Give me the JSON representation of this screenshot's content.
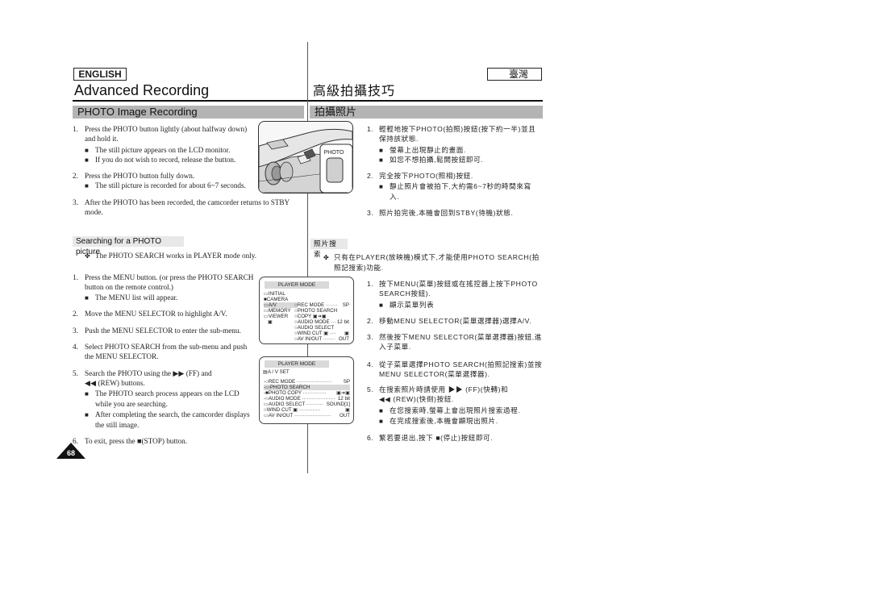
{
  "header": {
    "lang_en": "ENGLISH",
    "lang_zh": "臺灣",
    "title_en": "Advanced Recording",
    "title_zh": "高級拍攝技巧",
    "section_en": "PHOTO Image Recording",
    "section_zh": "拍攝照片"
  },
  "camera_image": {
    "label": "PHOTO"
  },
  "en_steps_top": [
    {
      "num": "1.",
      "lines": [
        "Press the PHOTO button lightly (about halfway down)",
        "and hold it."
      ]
    },
    {
      "bullet": "The still picture appears on the LCD monitor."
    },
    {
      "bullet": "If you do not wish to record, release the button."
    },
    {
      "num": "2.",
      "lines": [
        "Press the PHOTO button fully down."
      ]
    },
    {
      "bullet": "The still picture is recorded for about 6~7 seconds."
    },
    {
      "num": "3.",
      "lines": [
        "After the PHOTO has been recorded, the camcorder returns to STBY",
        "mode."
      ]
    }
  ],
  "zh_steps_top": [
    {
      "num": "1.",
      "lines": [
        "輕輕地按下PHOTO(拍照)按鈕(按下約一半)並且",
        "保持該狀態."
      ]
    },
    {
      "bullet": "螢幕上出現靜止的畫面."
    },
    {
      "bullet": "如您不想拍攝,鬆開按鈕即可."
    },
    {
      "num": "2.",
      "lines": [
        "完全按下PHOTO(照相)按鈕."
      ]
    },
    {
      "bullet": "靜止照片會被拍下,大約需6~7秒的時間來寫",
      "cont": "入."
    },
    {
      "num": "3.",
      "lines": [
        "照片拍完後,本機會回到STBY(待機)狀態."
      ]
    }
  ],
  "search_section": {
    "title_en": "Searching for a PHOTO picture",
    "title_zh": "照片搜索",
    "note_en": "The PHOTO SEARCH works in PLAYER mode only.",
    "note_zh": [
      "只有在PLAYER(放映機)模式下,才能使用PHOTO SEARCH(拍",
      "照記搜索)功能."
    ],
    "note_icon": "✤"
  },
  "en_steps_search": {
    "s1": [
      "Press the MENU button. (or press the PHOTO SEARCH",
      "button on the remote control.)"
    ],
    "s1b": "The MENU list will appear.",
    "s2": "Move the MENU SELECTOR to highlight A/V.",
    "s3": "Push the MENU SELECTOR to enter the sub-menu.",
    "s4": [
      "Select PHOTO SEARCH from the sub-menu and push",
      "the MENU SELECTOR."
    ],
    "s5a": "Search the PHOTO using the",
    "s5b": "(FF) and",
    "s5c": "(REW) buttons.",
    "s5b1": [
      "The PHOTO search process appears on the LCD",
      "while you are searching."
    ],
    "s5b2": [
      "After completing the search, the camcorder displays",
      "the still image."
    ],
    "s6a": "To exit, press the",
    "s6b": "(STOP) button."
  },
  "zh_steps_search": {
    "s1": [
      "按下MENU(菜單)按鈕或在搖控器上按下PHOTO",
      "SEARCH按鈕)."
    ],
    "s1b": "顯示菜單列表",
    "s2": "移動MENU SELECTOR(菜單選擇器)選擇A/V.",
    "s3": [
      "然後按下MENU SELECTOR(菜單選擇器)按鈕,進",
      "入子菜單."
    ],
    "s4": [
      "從子菜單選擇PHOTO SEARCH(拍照記搜索)並按",
      "MENU SELECTOR(菜單選擇器)."
    ],
    "s5a": "在搜索照片時請使用",
    "s5b": "(FF)(快轉)和",
    "s5c": "(REW)(快倒)按鈕.",
    "s5b1": "在您搜索時,螢幕上會出現照片搜索過程.",
    "s5b2": "在完成搜索後,本機會顯現出照片.",
    "s6a": "繁若要退出,按下",
    "s6b": "(停止)按鈕即可."
  },
  "screen1": {
    "header": "PLAYER MODE",
    "left": [
      "INITIAL",
      "CAMERA",
      "A/V",
      "MEMORY",
      "VIEWER"
    ],
    "right": [
      {
        "label": "REC MODE",
        "value": "SP"
      },
      {
        "label": "PHOTO SEARCH",
        "value": ""
      },
      {
        "label": "COPY",
        "value": ""
      },
      {
        "label": "AUDIO MODE",
        "value": "12 bit"
      },
      {
        "label": "AUDIO SELECT",
        "value": ""
      },
      {
        "label": "WIND CUT",
        "value": ""
      },
      {
        "label": "AV IN/OUT",
        "value": "OUT"
      }
    ]
  },
  "screen2": {
    "header": "PLAYER MODE",
    "title": "A / V SET",
    "rows": [
      {
        "label": "REC MODE",
        "value": "SP"
      },
      {
        "label": "PHOTO SEARCH",
        "value": ""
      },
      {
        "label": "PHOTO COPY",
        "value": ""
      },
      {
        "label": "AUDIO MODE",
        "value": "12 bit"
      },
      {
        "label": "AUDIO SELECT",
        "value": "SOUND[1]"
      },
      {
        "label": "WIND CUT",
        "value": ""
      },
      {
        "label": "AV IN/OUT",
        "value": "OUT"
      }
    ]
  },
  "page_number": "68"
}
